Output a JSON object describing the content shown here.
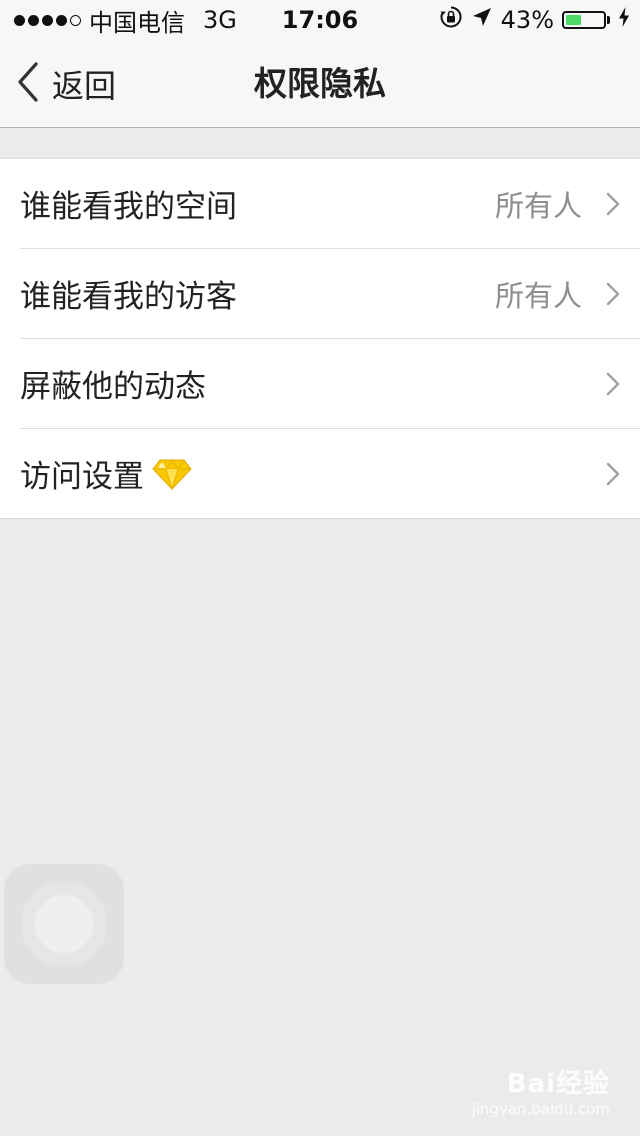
{
  "status_bar": {
    "carrier": "中国电信",
    "network": "3G",
    "time": "17:06",
    "battery_percent": "43%",
    "battery_level": 0.43,
    "battery_color": "#4cd964",
    "icons": [
      "rotation-lock-icon",
      "location-arrow-icon",
      "charging-bolt-icon"
    ]
  },
  "nav": {
    "back_label": "返回",
    "title": "权限隐私"
  },
  "settings": {
    "items": [
      {
        "label": "谁能看我的空间",
        "value": "所有人"
      },
      {
        "label": "谁能看我的访客",
        "value": "所有人"
      },
      {
        "label": "屏蔽他的动态",
        "value": ""
      },
      {
        "label": "访问设置",
        "value": "",
        "icon": "diamond-icon"
      }
    ]
  },
  "watermark": {
    "logo": "Bai经验",
    "sub": "jingyan.baidu.com"
  }
}
